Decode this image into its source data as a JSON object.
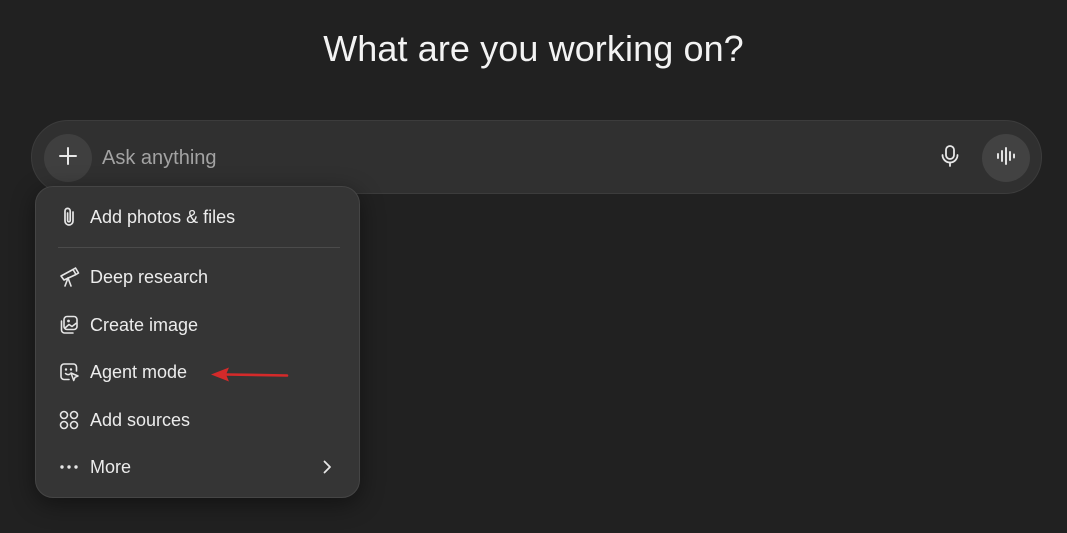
{
  "heading": "What are you working on?",
  "composer": {
    "placeholder": "Ask anything",
    "add_icon": "plus-icon",
    "mic_icon": "microphone-icon",
    "voice_icon": "voice-waveform-icon"
  },
  "menu": {
    "items": [
      {
        "label": "Add photos & files",
        "icon": "paperclip-icon"
      },
      {
        "label": "Deep research",
        "icon": "telescope-icon"
      },
      {
        "label": "Create image",
        "icon": "image-icon"
      },
      {
        "label": "Agent mode",
        "icon": "agent-cursor-icon"
      },
      {
        "label": "Add sources",
        "icon": "sources-icon"
      },
      {
        "label": "More",
        "icon": "more-dots-icon",
        "submenu": true
      }
    ]
  },
  "annotation": {
    "arrow_color": "#d42a2a",
    "target": "Agent mode"
  }
}
